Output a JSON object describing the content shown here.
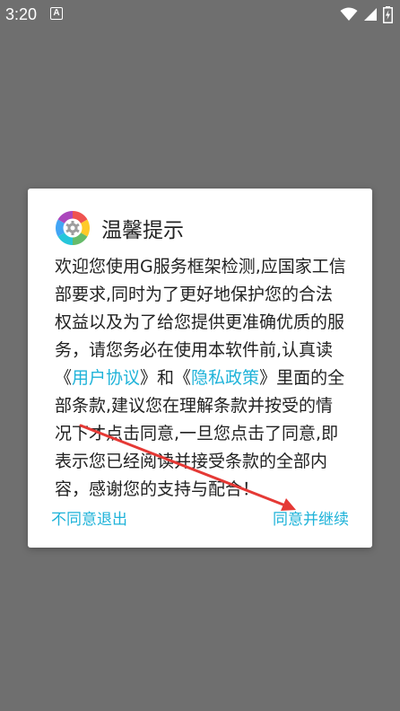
{
  "status": {
    "time": "3:20",
    "notification_glyph": "A",
    "icons": [
      "wifi-icon",
      "signal-icon",
      "battery-charging-icon"
    ]
  },
  "dialog": {
    "title": "温馨提示",
    "body_before": "欢迎您使用G服务框架检测,应国家工信部要求,同时为了更好地保护您的合法权益以及为了给您提供更准确优质的服务，请您务必在使用本软件前,认真读《",
    "link_user_agreement": "用户协议",
    "body_middle": "》和《",
    "link_privacy_policy": "隐私政策",
    "body_after": "》里面的全部条款,建议您在理解条款并按受的情况下才点击同意,一旦您点击了同意,即表示您已经阅读并接受条款的全部内容，感谢您的支持与配合！",
    "decline_label": "不同意退出",
    "accept_label": "同意并继续"
  },
  "colors": {
    "accent": "#1fb3d9",
    "arrow": "#e53935",
    "overlay": "#6f6f6f"
  }
}
